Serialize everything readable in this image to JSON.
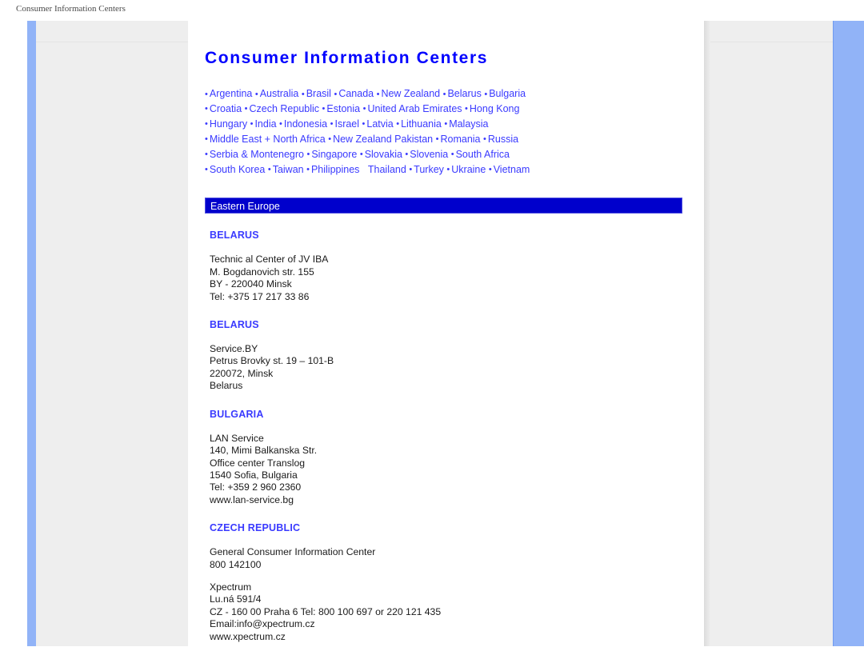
{
  "document": {
    "caption": "Consumer Information Centers",
    "title": "Consumer Information Centers"
  },
  "colors": {
    "link_blue": "#3a3aff",
    "title_blue": "#0000ff",
    "banner_blue": "#0000cc",
    "panel_gray": "#eeeeee",
    "accent_blue": "#91b3f7"
  },
  "country_links": {
    "bullet": "•",
    "rows": [
      {
        "items": [
          {
            "label": "Argentina",
            "bullet_before": true
          },
          {
            "label": "Australia",
            "bullet_before": true
          },
          {
            "label": "Brasil",
            "bullet_before": true
          },
          {
            "label": "Canada",
            "bullet_before": true
          },
          {
            "label": "New Zealand",
            "bullet_before": true
          },
          {
            "label": "Belarus",
            "bullet_before": true
          },
          {
            "label": "Bulgaria",
            "bullet_before": true
          }
        ]
      },
      {
        "items": [
          {
            "label": "Croatia",
            "bullet_before": true
          },
          {
            "label": "Czech Republic",
            "bullet_before": true
          },
          {
            "label": "Estonia",
            "bullet_before": true
          },
          {
            "label": "United Arab Emirates",
            "bullet_before": true
          },
          {
            "label": "Hong Kong",
            "bullet_before": true
          }
        ]
      },
      {
        "items": [
          {
            "label": "Hungary",
            "bullet_before": true
          },
          {
            "label": "India",
            "bullet_before": true
          },
          {
            "label": "Indonesia",
            "bullet_before": true
          },
          {
            "label": "Israel",
            "bullet_before": true
          },
          {
            "label": "Latvia",
            "bullet_before": true
          },
          {
            "label": "Lithuania",
            "bullet_before": true
          },
          {
            "label": "Malaysia",
            "bullet_before": true
          }
        ]
      },
      {
        "items": [
          {
            "label": "Middle East + North Africa",
            "bullet_before": true
          },
          {
            "label": "New Zealand Pakistan",
            "bullet_before": true
          },
          {
            "label": "Romania",
            "bullet_before": true
          },
          {
            "label": "Russia",
            "bullet_before": true
          }
        ]
      },
      {
        "items": [
          {
            "label": "Serbia & Montenegro",
            "bullet_before": true
          },
          {
            "label": "Singapore",
            "bullet_before": true
          },
          {
            "label": "Slovakia",
            "bullet_before": true
          },
          {
            "label": "Slovenia",
            "bullet_before": true
          },
          {
            "label": "South Africa",
            "bullet_before": true
          }
        ]
      },
      {
        "items": [
          {
            "label": "South Korea",
            "bullet_before": true
          },
          {
            "label": "Taiwan",
            "bullet_before": true
          },
          {
            "label": "Philippines",
            "bullet_before": true
          },
          {
            "label": "Thailand",
            "bullet_before": false
          },
          {
            "label": "Turkey",
            "bullet_before": true
          },
          {
            "label": "Ukraine",
            "bullet_before": true
          },
          {
            "label": "Vietnam",
            "bullet_before": true
          }
        ]
      }
    ]
  },
  "region_banner": {
    "label": "Eastern Europe"
  },
  "sections": [
    {
      "heading": "BELARUS",
      "blocks": [
        {
          "lines": [
            "Technic al Center of JV IBA",
            "M. Bogdanovich str. 155",
            "BY - 220040 Minsk",
            "Tel: +375 17 217 33 86"
          ]
        }
      ]
    },
    {
      "heading": "BELARUS",
      "blocks": [
        {
          "lines": [
            "Service.BY",
            "Petrus Brovky st. 19 – 101-B",
            "220072, Minsk",
            "Belarus"
          ]
        }
      ]
    },
    {
      "heading": "BULGARIA",
      "blocks": [
        {
          "lines": [
            "LAN Service",
            "140, Mimi Balkanska Str.",
            "Office center Translog",
            "1540 Sofia, Bulgaria",
            "Tel: +359 2 960 2360",
            "www.lan-service.bg"
          ]
        }
      ]
    },
    {
      "heading": "CZECH REPUBLIC",
      "blocks": [
        {
          "lines": [
            "General Consumer Information Center",
            "800 142100"
          ]
        },
        {
          "lines": [
            "Xpectrum",
            "Lu.ná 591/4",
            "CZ - 160 00 Praha 6 Tel: 800 100 697 or 220 121 435",
            "Email:info@xpectrum.cz",
            "www.xpectrum.cz"
          ]
        }
      ]
    }
  ]
}
